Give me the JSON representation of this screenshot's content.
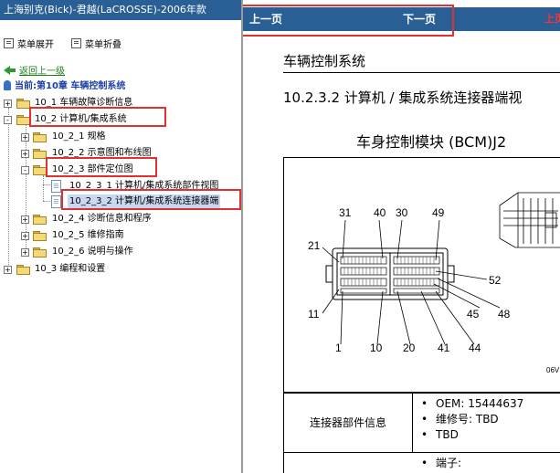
{
  "left_panel": {
    "title": "上海别克(Bick)-君越(LaCROSSE)-2006年款",
    "toolbar": {
      "expand_label": "菜单展开",
      "collapse_label": "菜单折叠"
    },
    "back_link": "返回上一级",
    "current_label": "当前:第10章 车辆控制系统",
    "tree": [
      {
        "label": "10_1 车辆故障诊断信息",
        "toggle": "+",
        "icon": "folder-icon"
      },
      {
        "label": "10_2 计算机/集成系统",
        "toggle": "-",
        "icon": "folder-open-icon"
      },
      {
        "label": "10_2_1 规格",
        "toggle": "+",
        "icon": "folder-icon"
      },
      {
        "label": "10_2_2 示意图和布线图",
        "toggle": "+",
        "icon": "folder-icon"
      },
      {
        "label": "10_2_3 部件定位图",
        "toggle": "-",
        "icon": "folder-open-icon"
      },
      {
        "label": "10_2_3_1 计算机/集成系统部件视图",
        "toggle": "",
        "icon": "document-icon"
      },
      {
        "label": "10_2_3_2 计算机/集成系统连接器端",
        "toggle": "",
        "icon": "document-icon",
        "selected": true
      },
      {
        "label": "10_2_4 诊断信息和程序",
        "toggle": "+",
        "icon": "folder-icon"
      },
      {
        "label": "10_2_5 维修指南",
        "toggle": "+",
        "icon": "folder-icon"
      },
      {
        "label": "10_2_6 说明与操作",
        "toggle": "+",
        "icon": "folder-icon"
      },
      {
        "label": "10_3 编程和设置",
        "toggle": "+",
        "icon": "folder-icon"
      }
    ]
  },
  "right_panel": {
    "nav": {
      "prev_label": "上一页",
      "next_label": "下一页",
      "edge_label": "上页"
    },
    "section_title": "车辆控制系统",
    "subsection_title": "10.2.3.2 计算机 / 集成系统连接器端视",
    "figure_title": "车身控制模块 (BCM)J2",
    "figure": {
      "pin_labels": [
        "31",
        "40",
        "30",
        "49",
        "21",
        "52",
        "11",
        "45",
        "48",
        "1",
        "10",
        "20",
        "41",
        "44"
      ],
      "code_fragment": "06V"
    },
    "info_table": {
      "label": "连接器部件信息",
      "items": [
        "OEM: 15444637",
        "维修号: TBD",
        "TBD"
      ],
      "next_item": "端子:"
    }
  },
  "colors": {
    "title_bar": "#2a5f96",
    "highlight_box": "#e03030",
    "back_link": "#1a7f1a",
    "current_label": "#1c3fa8"
  }
}
